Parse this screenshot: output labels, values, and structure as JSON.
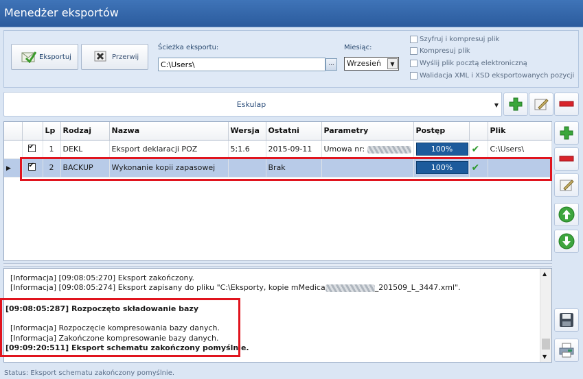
{
  "window": {
    "title": "Menedżer eksportów"
  },
  "toolbar": {
    "export_label": "Eksportuj",
    "cancel_label": "Przerwij"
  },
  "path": {
    "label": "Ścieżka eksportu:",
    "value": "C:\\Users\\",
    "browse_label": "..."
  },
  "month": {
    "label": "Miesiąc:",
    "value": "Wrzesień"
  },
  "options": [
    {
      "label": "Szyfruj i kompresuj plik",
      "checked": false
    },
    {
      "label": "Kompresuj plik",
      "checked": false
    },
    {
      "label": "Wyślij plik pocztą elektroniczną",
      "checked": false
    },
    {
      "label": "Walidacja XML i XSD eksportowanych pozycji",
      "checked": false
    }
  ],
  "profile": {
    "value": "Eskulap"
  },
  "table": {
    "columns": [
      "Lp",
      "Rodzaj",
      "Nazwa",
      "Wersja",
      "Ostatni",
      "Parametry",
      "Postęp",
      "Plik"
    ],
    "rows": [
      {
        "lp": "1",
        "rodzaj": "DEKL",
        "nazwa": "Eksport deklaracji POZ",
        "wersja": "5;1.6",
        "ostatni": "2015-09-11",
        "parametry": "Umowa nr:",
        "postep": "100%",
        "postep_value": 100,
        "plik": "C:\\Users\\",
        "checked": true,
        "selected": false
      },
      {
        "lp": "2",
        "rodzaj": "BACKUP",
        "nazwa": "Wykonanie kopii zapasowej",
        "wersja": "",
        "ostatni": "Brak",
        "parametry": "",
        "postep": "100%",
        "postep_value": 100,
        "plik": "",
        "checked": true,
        "selected": true
      }
    ]
  },
  "log": {
    "line1": "[Informacja] [09:08:05:270] Eksport zakończony.",
    "line2a": "[Informacja] [09:08:05:274] Eksport zapisany do pliku \"C:\\Eksporty, kopie mMedica",
    "line2b": "_201509_L_3447.xml\".",
    "line3": "[09:08:05:287] Rozpoczęto składowanie bazy",
    "line4": "[Informacja] Rozpoczęcie kompresowania bazy danych.",
    "line5": "[Informacja] Zakończone kompresowanie bazy danych.",
    "line6": "[09:09:20:511] Eksport schematu zakończony pomyślnie."
  },
  "status": {
    "text": "Status:  Eksport schematu zakończony pomyślnie."
  },
  "colors": {
    "title_bar": "#2f62a6",
    "highlight": "#e0141e",
    "progress": "#1d5b9c",
    "ok_green": "#2f9a2f"
  }
}
